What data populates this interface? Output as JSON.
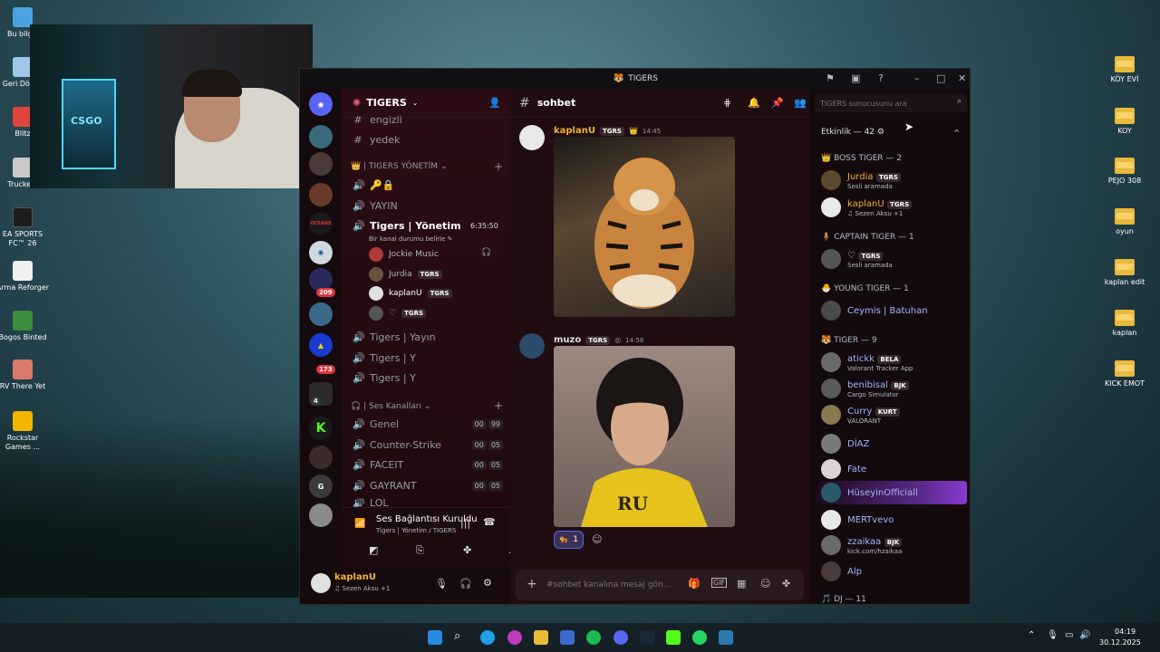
{
  "desktop": {
    "left_icons": [
      {
        "label": "Bu bilgis",
        "color": "#4aa3e0"
      },
      {
        "label": "Geri Dönüş",
        "color": "#9fc7e8"
      },
      {
        "label": "Blitz",
        "color": "#e0443d"
      },
      {
        "label": "Truckers",
        "color": "#c9c9c9"
      },
      {
        "label": "EA SPORTS FC™ 26",
        "color": "#1d1d1d"
      },
      {
        "label": "Arma Reforger",
        "color": "#f0f0f0"
      },
      {
        "label": "Bogos Binted",
        "color": "#3c8d3c"
      },
      {
        "label": "RV There Yet",
        "color": "#d97a6a"
      },
      {
        "label": "Rockstar Games ...",
        "color": "#f2b600"
      }
    ],
    "right_icons": [
      "KÖY EVİ",
      "KOY",
      "PEJO 308",
      "oyun",
      "kaplan edit",
      "kaplan",
      "KICK EMOT"
    ]
  },
  "webcam": {
    "logo": "CSGO"
  },
  "window": {
    "title": "TIGERS",
    "server_name": "TIGERS",
    "channel_name": "sohbet",
    "search_placeholder": "TIGERS sunucusunu ara",
    "rail_badges": [
      "209",
      "173",
      "4"
    ],
    "rail_labels": [
      "OCEANS",
      "G"
    ]
  },
  "channels": {
    "top": [
      "engizli",
      "yedek"
    ],
    "category_yonetim": "| TIGERS YÖNETİM",
    "yayin": "YAYIN",
    "yonetim_channel": "Tigers | Yönetim",
    "yonetim_timer": "6:35:50",
    "status_hint": "Bir kanal durumu belirle",
    "voice_users": [
      {
        "name": "Jockie Music",
        "tag": ""
      },
      {
        "name": "Jurdia",
        "tag": "TGRS"
      },
      {
        "name": "kaplanU",
        "tag": "TGRS"
      },
      {
        "name": "♡",
        "tag": "TGRS"
      }
    ],
    "more": [
      "Tigers | Yayın",
      "Tigers | Y",
      "Tigers | Y"
    ],
    "category_ses": "| Ses Kanalları",
    "voice_channels": [
      {
        "name": "Genel",
        "a": "00",
        "b": "99"
      },
      {
        "name": "Counter-Strike",
        "a": "00",
        "b": "05"
      },
      {
        "name": "FACEIT",
        "a": "00",
        "b": "05"
      },
      {
        "name": "GAYRANT",
        "a": "00",
        "b": "05"
      },
      {
        "name": "LOL",
        "a": "00",
        "b": "05"
      }
    ]
  },
  "voice_panel": {
    "status": "Ses Bağlantısı Kuruldu",
    "location": "Tigers | Yönetim / TIGERS"
  },
  "user_panel": {
    "name": "kaplanU",
    "activity": "♫ Sezen Aksu +1"
  },
  "messages": [
    {
      "author": "kaplanU",
      "tag": "TGRS",
      "time": "14:45"
    },
    {
      "author": "muzo",
      "tag": "TGRS",
      "time": "14:58",
      "image_text": "RU",
      "reaction_count": "1"
    }
  ],
  "composer_placeholder": "#sohbet kanalına mesaj gön...",
  "members": {
    "activity": "Etkinlik — 42",
    "roles": [
      {
        "label": "BOSS TIGER",
        "count": "— 2"
      },
      {
        "label": "CAPTAIN TIGER",
        "count": "— 1"
      },
      {
        "label": "YOUNG TIGER",
        "count": "— 1"
      },
      {
        "label": "TIGER",
        "count": "— 9"
      },
      {
        "label": "DJ",
        "count": "— 11"
      }
    ],
    "list": [
      {
        "name": "Jurdia",
        "tag": "TGRS",
        "sub": "Sesli aramada",
        "color": "#f0b232"
      },
      {
        "name": "kaplanU",
        "tag": "TGRS",
        "sub": "♫ Sezen Aksu +1",
        "color": "#f0b232"
      },
      {
        "name": "♡",
        "tag": "TGRS",
        "sub": "Sesli aramada",
        "color": "#dbdee1"
      },
      {
        "name": "Ceymis | Batuhan",
        "tag": "",
        "sub": "",
        "color": "#a5b4fc"
      },
      {
        "name": "atickk",
        "tag": "BELA",
        "sub": "Valorant Tracker App",
        "color": "#a5b4fc"
      },
      {
        "name": "benibisal",
        "tag": "BJK",
        "sub": "Cargo Simulator",
        "color": "#a5b4fc"
      },
      {
        "name": "Curry",
        "tag": "KURT",
        "sub": "VALORANT",
        "color": "#a5b4fc"
      },
      {
        "name": "DİAZ",
        "tag": "",
        "sub": "",
        "color": "#a5b4fc"
      },
      {
        "name": "Fate",
        "tag": "",
        "sub": "",
        "color": "#a5b4fc"
      },
      {
        "name": "HüseyinOfficiall",
        "tag": "",
        "sub": "",
        "color": "#a5b4fc"
      },
      {
        "name": "MERTvevo",
        "tag": "",
        "sub": "",
        "color": "#a5b4fc"
      },
      {
        "name": "zzaikaa",
        "tag": "BJK",
        "sub": "kick.com/hzaikaa",
        "color": "#a5b4fc"
      },
      {
        "name": "Alp",
        "tag": "",
        "sub": "",
        "color": "#a5b4fc"
      }
    ]
  },
  "tray": {
    "time": "04:19",
    "date": "30.12.2025"
  }
}
